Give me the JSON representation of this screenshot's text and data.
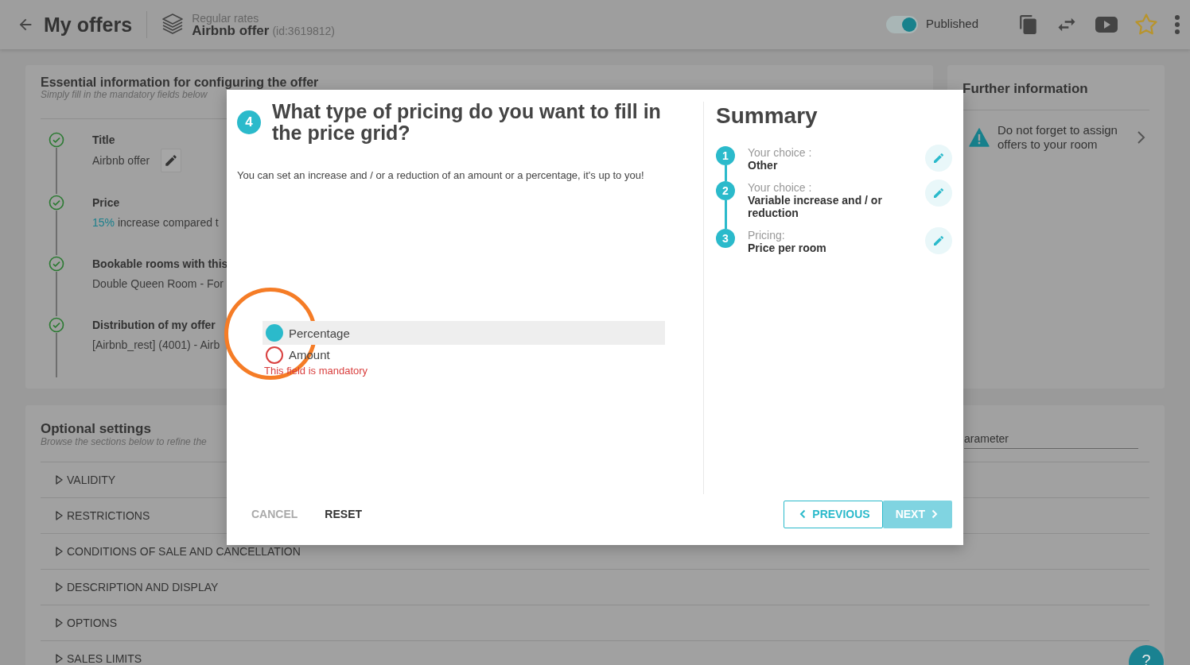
{
  "header": {
    "title": "My offers",
    "category": "Regular rates",
    "offer_name": "Airbnb offer",
    "offer_id": "(id:3619812)",
    "status": {
      "label": "Published",
      "on": true
    }
  },
  "essential": {
    "title": "Essential information for configuring the offer",
    "subtitle": "Simply fill in the mandatory fields below",
    "steps": [
      {
        "title": "Title",
        "value": "Airbnb offer",
        "done": true,
        "editable": true
      },
      {
        "title": "Price",
        "highlight": "15%",
        "value": "increase compared t",
        "done": true,
        "editable": false
      },
      {
        "title": "Bookable rooms with this",
        "value": "Double Queen Room - For",
        "done": true,
        "editable": false
      },
      {
        "title": "Distribution of my offer",
        "value": "[Airbnb_rest] (4001) - Airb",
        "done": true,
        "editable": false
      }
    ]
  },
  "further": {
    "title": "Further information",
    "alerts": [
      {
        "text": "Do not forget to assign offers to your room"
      }
    ]
  },
  "optional": {
    "title": "Optional settings",
    "subtitle": "Browse the sections below to refine the",
    "search": {
      "placeholder": "arameter"
    },
    "sections": [
      {
        "label": "VALIDITY",
        "expanded": false
      },
      {
        "label": "RESTRICTIONS",
        "expanded": false
      },
      {
        "label": "CONDITIONS OF SALE AND CANCELLATION",
        "expanded": false
      },
      {
        "label": "DESCRIPTION AND DISPLAY",
        "expanded": false
      },
      {
        "label": "OPTIONS",
        "expanded": false
      },
      {
        "label": "SALES LIMITS",
        "expanded": false
      }
    ]
  },
  "help": {
    "label": "?"
  },
  "dialog": {
    "step": "4",
    "question": "What type of pricing do you want to fill in the price grid?",
    "description": "You can set an increase and / or a reduction of an amount or a percentage, it's up to you!",
    "options": [
      {
        "label": "Percentage",
        "selected": true
      },
      {
        "label": "Amount",
        "selected": false
      }
    ],
    "error": "This field is mandatory",
    "summary": {
      "title": "Summary",
      "items": [
        {
          "number": "1",
          "label": "Your choice :",
          "value": "Other"
        },
        {
          "number": "2",
          "label": "Your choice :",
          "value": "Variable increase and / or reduction"
        },
        {
          "number": "3",
          "label": "Pricing:",
          "value": "Price per room"
        }
      ]
    },
    "buttons": [
      {
        "kind": "text",
        "label": "CANCEL",
        "disabled": true
      },
      {
        "kind": "text",
        "label": "RESET",
        "disabled": false
      },
      {
        "kind": "outlined",
        "label": "PREVIOUS",
        "disabled": false
      },
      {
        "kind": "filled",
        "label": "NEXT",
        "disabled": true
      }
    ]
  }
}
